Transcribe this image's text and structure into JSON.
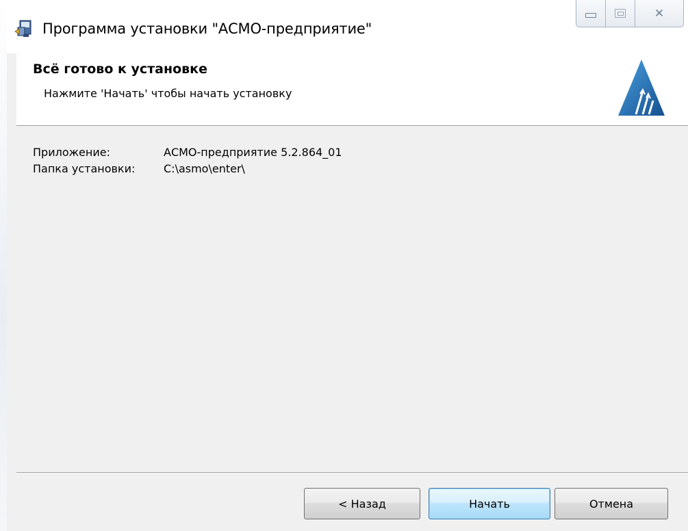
{
  "window": {
    "title": "Программа установки \"АСМО-предприятие\"",
    "icon": "installer-icon",
    "caption_buttons": [
      "minimize-icon",
      "maximize-icon",
      "close-icon"
    ],
    "close_glyph": "✕"
  },
  "header": {
    "title": "Всё готово к установке",
    "subtitle": "Нажмите 'Начать' чтобы начать установку",
    "logo": "asmo-logo",
    "logo_color": "#1f6fb5"
  },
  "info": {
    "rows": [
      {
        "label": "Приложение:",
        "value": "АСМО-предприятие 5.2.864_01"
      },
      {
        "label": "Папка установки:",
        "value": "C:\\asmo\\enter\\"
      }
    ]
  },
  "buttons": {
    "back": "< Назад",
    "start": "Начать",
    "cancel": "Отмена"
  },
  "colors": {
    "window_bg": "#f0f0f0",
    "header_bg": "#ffffff",
    "default_button_border": "#3c7fb1"
  }
}
